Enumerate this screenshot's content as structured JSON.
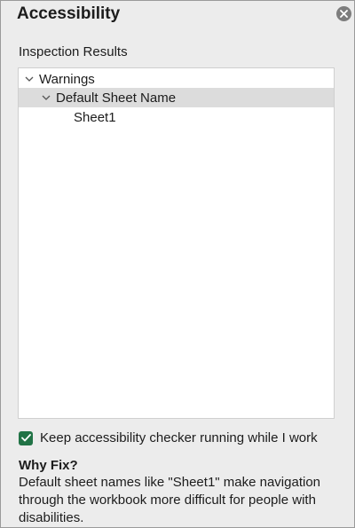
{
  "pane": {
    "title": "Accessibility",
    "close_icon": "close-icon"
  },
  "inspection": {
    "label": "Inspection Results"
  },
  "tree": {
    "warnings_label": "Warnings",
    "issue_label": "Default Sheet Name",
    "sheet_label": "Sheet1",
    "selected_row": "Default Sheet Name"
  },
  "option": {
    "keep_running_label": "Keep accessibility checker running while I work",
    "checked": true
  },
  "why_fix": {
    "title": "Why Fix?",
    "text": "Default sheet names like \"Sheet1\" make navigation through the workbook more difficult for people with disabilities."
  },
  "colors": {
    "checkbox": "#217346",
    "selection": "#dcdcdc",
    "background": "#ececec"
  }
}
